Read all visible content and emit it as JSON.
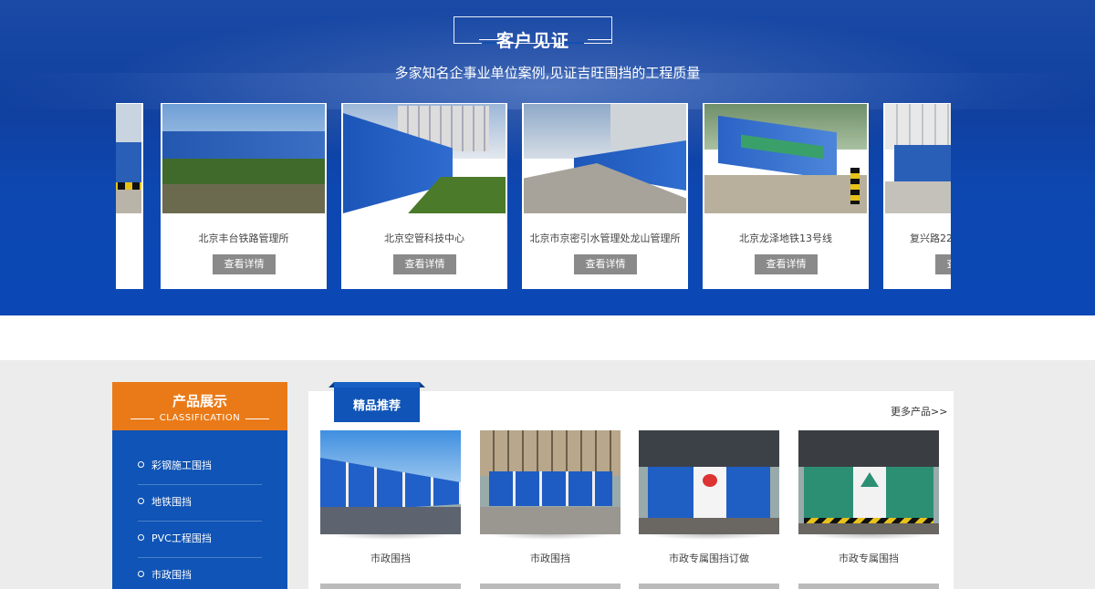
{
  "testimonials": {
    "title": "客户见证",
    "subtitle": "多家知名企事业单位案例,见证吉旺围挡的工程质量",
    "button_label": "查看详情",
    "cases": [
      {
        "name": "北京丰台铁路管理所"
      },
      {
        "name": "北京空管科技中心"
      },
      {
        "name": "北京市京密引水管理处龙山管理所"
      },
      {
        "name": "北京龙泽地铁13号线"
      },
      {
        "name": "复兴路22"
      }
    ]
  },
  "categories": {
    "title": "产品展示",
    "subtitle": "CLASSIFICATION",
    "items": [
      {
        "label": "彩钢施工围挡"
      },
      {
        "label": "地铁围挡"
      },
      {
        "label": "PVC工程围挡"
      },
      {
        "label": "市政围挡"
      }
    ]
  },
  "featured": {
    "tab_label": "精品推荐",
    "more_label": "更多产品>>",
    "products": [
      {
        "name": "市政围挡"
      },
      {
        "name": "市政围挡"
      },
      {
        "name": "市政专属围挡订做"
      },
      {
        "name": "市政专属围挡"
      }
    ]
  },
  "colors": {
    "brand_blue": "#0f54b6",
    "accent_orange": "#ea7a17",
    "button_gray": "#8a8a8a"
  }
}
